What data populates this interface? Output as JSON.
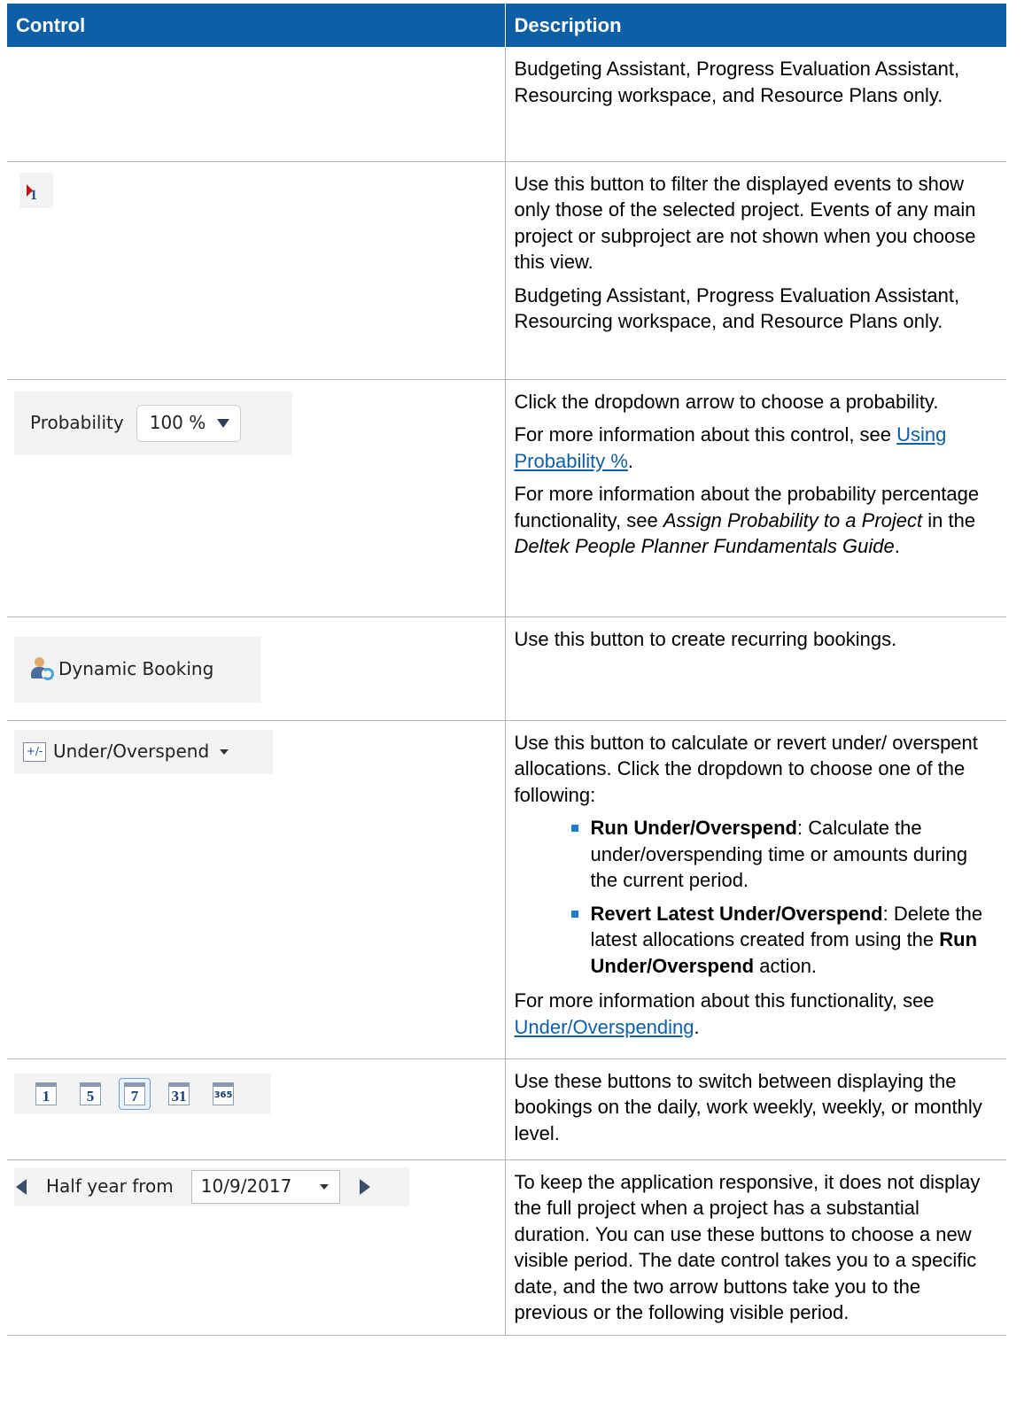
{
  "header": {
    "control": "Control",
    "description": "Description"
  },
  "rows": {
    "r0": {
      "desc_p1": "Budgeting Assistant, Progress Evaluation Assistant, Resourcing workspace, and Resource Plans only."
    },
    "r1": {
      "icon_label": "1",
      "desc_p1": "Use this button to filter the displayed events to show only those of the selected project. Events of any main project or subproject are not shown when you choose this view.",
      "desc_p2": "Budgeting Assistant, Progress Evaluation Assistant, Resourcing workspace, and Resource Plans only."
    },
    "r2": {
      "control_label": "Probability",
      "control_value": "100 %",
      "desc_p1": "Click the dropdown arrow to choose a probability.",
      "desc_p2_pre": "For more information about this control, see ",
      "desc_p2_link": "Using Probability %",
      "desc_p2_post": ".",
      "desc_p3_pre": "For more information about the probability percentage functionality, see ",
      "desc_p3_em1": "Assign Probability to a Project",
      "desc_p3_mid": " in the ",
      "desc_p3_em2": "Deltek People Planner Fundamentals Guide",
      "desc_p3_post": "."
    },
    "r3": {
      "control_label": "Dynamic Booking",
      "desc_p1": "Use this button to create recurring bookings."
    },
    "r4": {
      "control_icon_text": "+/-",
      "control_label": "Under/Overspend",
      "desc_p1": "Use this button to calculate or revert under/ overspent allocations. Click the dropdown to choose one of the following:",
      "bullet1_bold": "Run Under/Overspend",
      "bullet1_text": ": Calculate the under/overspending time or amounts during the current period.",
      "bullet2_bold": "Revert Latest Under/Overspend",
      "bullet2_text_pre": ": Delete the latest allocations created from using the ",
      "bullet2_bold2": "Run Under/Overspend",
      "bullet2_text_post": " action.",
      "desc_p2_pre": "For more information about this functionality, see ",
      "desc_p2_link": "Under/Overspending",
      "desc_p2_post": "."
    },
    "r5": {
      "view_buttons": [
        "1",
        "5",
        "7",
        "31",
        "365"
      ],
      "desc_p1": "Use these buttons to switch between displaying the bookings on the daily, work weekly, weekly, or monthly level."
    },
    "r6": {
      "control_label": "Half year from",
      "date_value": "10/9/2017",
      "desc_p1": "To keep the application responsive, it does not display the full project when a project has a substantial duration. You can use these buttons to choose a new visible period. The date control takes you to a specific date, and the two arrow buttons take you to the previous or the following visible period."
    }
  }
}
